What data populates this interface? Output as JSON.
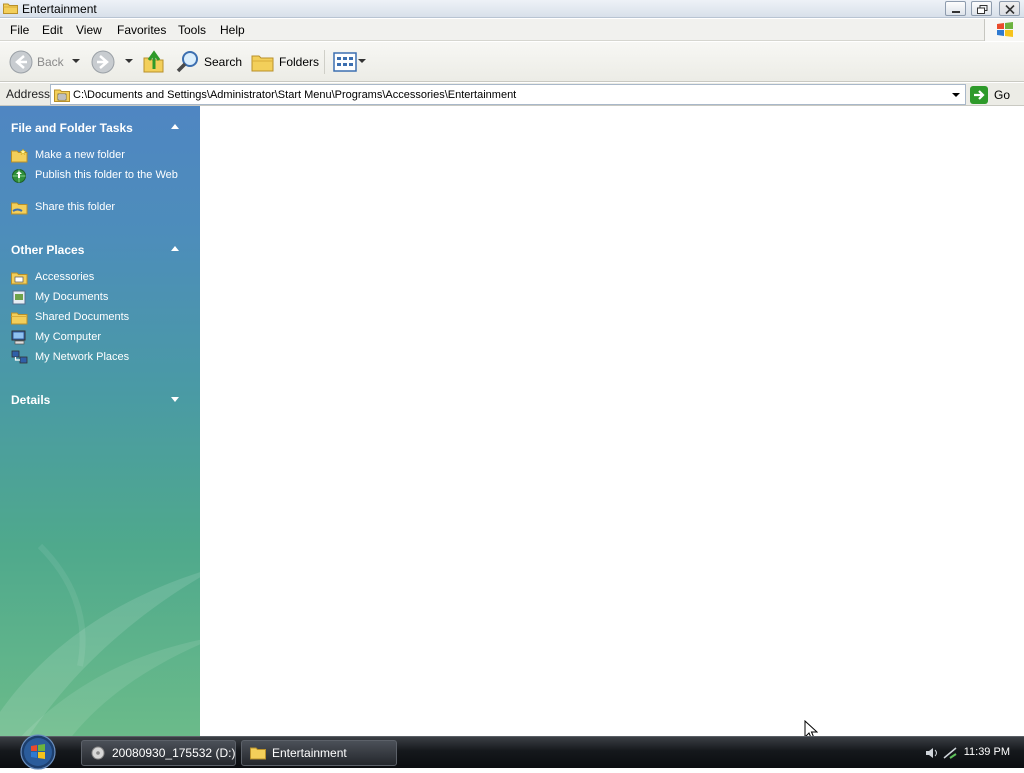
{
  "window": {
    "title": "Entertainment"
  },
  "menubar": {
    "items": [
      "File",
      "Edit",
      "View",
      "Favorites",
      "Tools",
      "Help"
    ]
  },
  "toolbar": {
    "back_label": "Back",
    "search_label": "Search",
    "folders_label": "Folders"
  },
  "address": {
    "label": "Address",
    "value": "C:\\Documents and Settings\\Administrator\\Start Menu\\Programs\\Accessories\\Entertainment",
    "go_label": "Go"
  },
  "taskpane": {
    "file_tasks": {
      "header": "File and Folder Tasks",
      "items": [
        {
          "label": "Make a new folder",
          "icon": "new-folder-icon"
        },
        {
          "label": "Publish this folder to the Web",
          "icon": "publish-web-icon"
        },
        {
          "label": "Share this folder",
          "icon": "share-folder-icon"
        }
      ]
    },
    "other_places": {
      "header": "Other Places",
      "items": [
        {
          "label": "Accessories",
          "icon": "folder-icon"
        },
        {
          "label": "My Documents",
          "icon": "my-documents-icon"
        },
        {
          "label": "Shared Documents",
          "icon": "folder-icon"
        },
        {
          "label": "My Computer",
          "icon": "my-computer-icon"
        },
        {
          "label": "My Network Places",
          "icon": "network-places-icon"
        }
      ]
    },
    "details": {
      "header": "Details"
    }
  },
  "taskbar": {
    "tasks": [
      {
        "label": "20080930_175532 (D:)",
        "icon": "drive-icon"
      },
      {
        "label": "Entertainment",
        "icon": "folder-icon"
      }
    ],
    "clock": "11:39 PM"
  },
  "colors": {
    "taskpane_top": "#4f86c2",
    "taskpane_bottom": "#6bbb8a",
    "go_green": "#2e9a2a",
    "taskbar": "#15181c"
  }
}
